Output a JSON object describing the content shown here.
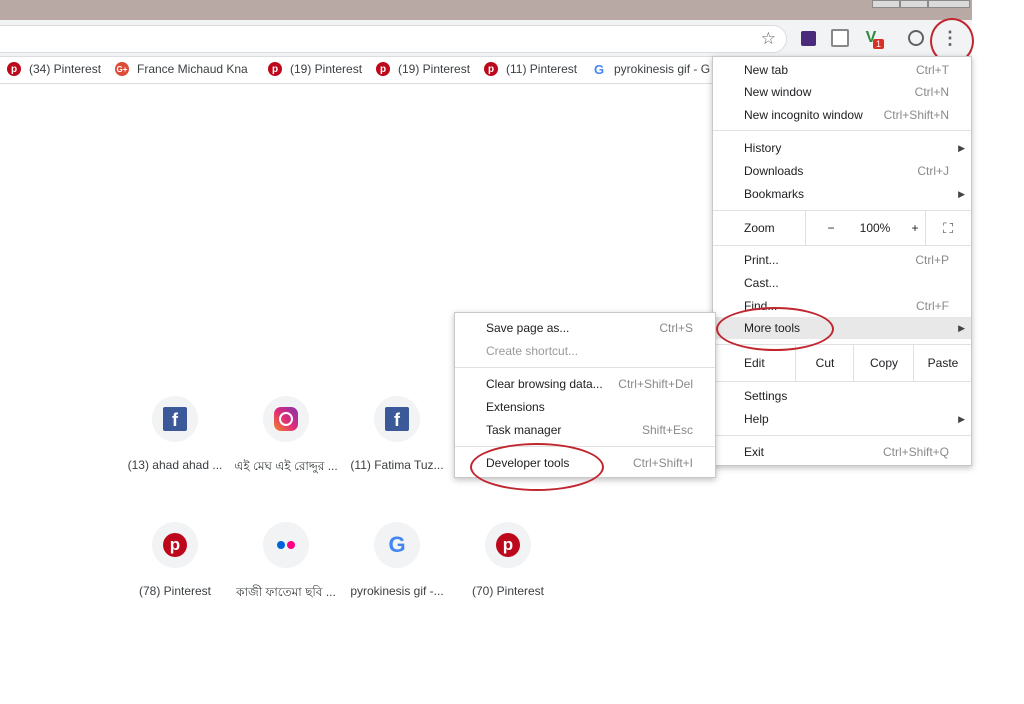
{
  "browser": {
    "menu_icon": "kebab-menu-icon",
    "bookmark_icon": "star-icon",
    "extensions": [
      {
        "name": "purple-extension-icon"
      },
      {
        "name": "gray-extension-icon"
      },
      {
        "name": "shield-extension-icon",
        "badge": "1"
      }
    ],
    "profile_icon": "profile-icon"
  },
  "bookmarks": [
    {
      "label": "(34) Pinterest",
      "icon": "pinterest"
    },
    {
      "label": "France Michaud Kna",
      "icon": "google-plus"
    },
    {
      "label": "(19) Pinterest",
      "icon": "pinterest"
    },
    {
      "label": "(19) Pinterest",
      "icon": "pinterest"
    },
    {
      "label": "(11) Pinterest",
      "icon": "pinterest"
    },
    {
      "label": "pyrokinesis gif - G",
      "icon": "google"
    }
  ],
  "tiles": [
    {
      "label": "(13) ahad ahad ...",
      "icon": "facebook"
    },
    {
      "label": "এই মেঘ এই রোদ্দুর ...",
      "icon": "instagram"
    },
    {
      "label": "(11) Fatima Tuz...",
      "icon": "facebook"
    },
    {
      "label": "(78) Pinterest",
      "icon": "pinterest"
    },
    {
      "label": "কাজী ফাতেমা ছবি ...",
      "icon": "flickr"
    },
    {
      "label": "pyrokinesis gif -...",
      "icon": "google"
    },
    {
      "label": "(70) Pinterest",
      "icon": "pinterest"
    }
  ],
  "main_menu": {
    "new_tab": {
      "label": "New tab",
      "shortcut": "Ctrl+T"
    },
    "new_window": {
      "label": "New window",
      "shortcut": "Ctrl+N"
    },
    "new_incognito": {
      "label": "New incognito window",
      "shortcut": "Ctrl+Shift+N"
    },
    "history": {
      "label": "History"
    },
    "downloads": {
      "label": "Downloads",
      "shortcut": "Ctrl+J"
    },
    "bookmarks": {
      "label": "Bookmarks"
    },
    "zoom": {
      "label": "Zoom",
      "minus": "−",
      "value": "100%",
      "plus": "+"
    },
    "print": {
      "label": "Print...",
      "shortcut": "Ctrl+P"
    },
    "cast": {
      "label": "Cast..."
    },
    "find": {
      "label": "Find...",
      "shortcut": "Ctrl+F"
    },
    "more_tools": {
      "label": "More tools"
    },
    "edit": {
      "label": "Edit",
      "cut": "Cut",
      "copy": "Copy",
      "paste": "Paste"
    },
    "settings": {
      "label": "Settings"
    },
    "help": {
      "label": "Help"
    },
    "exit": {
      "label": "Exit",
      "shortcut": "Ctrl+Shift+Q"
    }
  },
  "more_tools_menu": {
    "save_page": {
      "label": "Save page as...",
      "shortcut": "Ctrl+S"
    },
    "create_shortcut": {
      "label": "Create shortcut..."
    },
    "clear_browsing": {
      "label": "Clear browsing data...",
      "shortcut": "Ctrl+Shift+Del"
    },
    "extensions": {
      "label": "Extensions"
    },
    "task_manager": {
      "label": "Task manager",
      "shortcut": "Shift+Esc"
    },
    "developer_tools": {
      "label": "Developer tools",
      "shortcut": "Ctrl+Shift+I"
    }
  },
  "colors": {
    "annotation_circle": "#c0262e",
    "pinterest": "#bd081c",
    "facebook": "#3b5998"
  }
}
